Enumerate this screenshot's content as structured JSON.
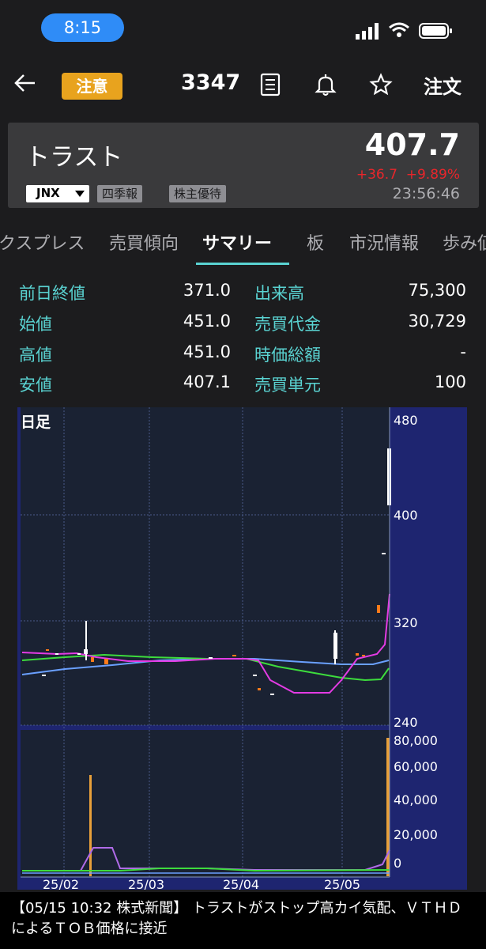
{
  "status_bar": {
    "time": "8:15"
  },
  "header": {
    "warning_badge": "注意",
    "code": "3347",
    "order_label": "注文",
    "icons": [
      "back-arrow-icon",
      "document-icon",
      "bell-icon",
      "star-icon"
    ]
  },
  "stock": {
    "name": "トラスト",
    "price": "407.7",
    "change": "+36.7",
    "change_pct": "+9.89%",
    "time": "23:56:46",
    "market": "JNX",
    "tags": [
      "四季報",
      "株主優待"
    ]
  },
  "tabs": [
    "クスプレス",
    "売買傾向",
    "サマリー",
    "板",
    "市況情報",
    "歩み値"
  ],
  "active_tab": "サマリー",
  "summary": {
    "left": [
      {
        "label": "前日終値",
        "value": "371.0"
      },
      {
        "label": "始値",
        "value": "451.0"
      },
      {
        "label": "高値",
        "value": "451.0"
      },
      {
        "label": "安値",
        "value": "407.1"
      }
    ],
    "right": [
      {
        "label": "出来高",
        "value": "75,300"
      },
      {
        "label": "売買代金",
        "value": "30,729"
      },
      {
        "label": "時価総額",
        "value": "-"
      },
      {
        "label": "売買単元",
        "value": "100"
      }
    ]
  },
  "chart": {
    "label": "日足",
    "price_ticks": [
      "480",
      "400",
      "320",
      "240"
    ],
    "volume_ticks": [
      "80,000",
      "60,000",
      "40,000",
      "20,000",
      "0"
    ],
    "date_ticks": [
      "25/02",
      "25/03",
      "25/04",
      "25/05"
    ]
  },
  "chart_data": {
    "type": "candlestick",
    "price_axis": {
      "ylim": [
        240,
        480
      ]
    },
    "volume_axis": {
      "ylim": [
        0,
        80000
      ]
    },
    "dates": [
      "25/02",
      "25/03",
      "25/04",
      "25/05"
    ],
    "ma_colors": {
      "short": "#e43be4",
      "mid": "#3ddc3d",
      "long": "#6aa0ff"
    },
    "volume_color": "#e8a03a",
    "latest": {
      "open": 451.0,
      "high": 451.0,
      "low": 407.1,
      "close": 407.7,
      "volume": 75300
    }
  },
  "news": "【05/15 10:32 株式新聞】 トラストがストップ高カイ気配、ＶＴＨＤによるＴＯＢ価格に接近"
}
